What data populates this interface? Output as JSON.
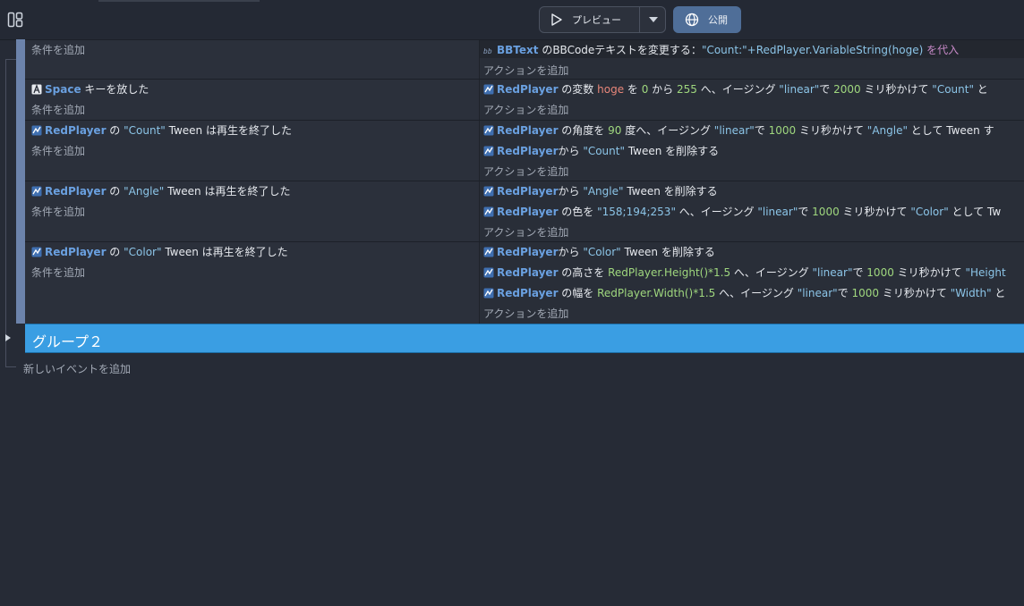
{
  "toolbar": {
    "preview_label": "プレビュー",
    "publish_label": "公開"
  },
  "events": [
    {
      "conditions": [],
      "add_condition": "条件を追加",
      "actions": [
        {
          "parts": [
            {
              "t": "obj",
              "v": "BBText"
            },
            {
              "t": "txt",
              "v": " のBBCodeテキストを変更する："
            },
            {
              "t": "str",
              "v": "\"Count:\"+RedPlayer.VariableString(hoge)"
            },
            {
              "t": "assign",
              "v": " を代入"
            }
          ],
          "icon": "text-object-icon"
        }
      ],
      "add_action": "アクションを追加"
    },
    {
      "conditions": [
        {
          "parts": [
            {
              "t": "obj",
              "v": "Space"
            },
            {
              "t": "txt",
              "v": " キーを放した"
            }
          ],
          "icon": "keyboard-key-icon"
        }
      ],
      "add_condition": "条件を追加",
      "actions": [
        {
          "parts": [
            {
              "t": "obj",
              "v": "RedPlayer"
            },
            {
              "t": "txt",
              "v": " の変数 "
            },
            {
              "t": "var",
              "v": "hoge"
            },
            {
              "t": "txt",
              "v": " を "
            },
            {
              "t": "num",
              "v": "0"
            },
            {
              "t": "txt",
              "v": " から "
            },
            {
              "t": "num",
              "v": "255"
            },
            {
              "t": "txt",
              "v": " へ、イージング "
            },
            {
              "t": "str",
              "v": "\"linear\""
            },
            {
              "t": "txt",
              "v": "で "
            },
            {
              "t": "num",
              "v": "2000"
            },
            {
              "t": "txt",
              "v": " ミリ秒かけて "
            },
            {
              "t": "str",
              "v": "\"Count\""
            },
            {
              "t": "txt",
              "v": " と"
            }
          ],
          "icon": "sprite-icon"
        }
      ],
      "add_action": "アクションを追加"
    },
    {
      "conditions": [
        {
          "parts": [
            {
              "t": "obj",
              "v": "RedPlayer"
            },
            {
              "t": "txt",
              "v": " の "
            },
            {
              "t": "str",
              "v": "\"Count\""
            },
            {
              "t": "txt",
              "v": " Tween は再生を終了した"
            }
          ],
          "icon": "sprite-icon"
        }
      ],
      "add_condition": "条件を追加",
      "actions": [
        {
          "parts": [
            {
              "t": "obj",
              "v": "RedPlayer"
            },
            {
              "t": "txt",
              "v": " の角度を "
            },
            {
              "t": "num",
              "v": "90"
            },
            {
              "t": "txt",
              "v": " 度へ、イージング "
            },
            {
              "t": "str",
              "v": "\"linear\""
            },
            {
              "t": "txt",
              "v": "で "
            },
            {
              "t": "num",
              "v": "1000"
            },
            {
              "t": "txt",
              "v": " ミリ秒かけて "
            },
            {
              "t": "str",
              "v": "\"Angle\""
            },
            {
              "t": "txt",
              "v": " として Tween す"
            }
          ],
          "icon": "sprite-icon"
        },
        {
          "parts": [
            {
              "t": "obj",
              "v": "RedPlayer"
            },
            {
              "t": "txt",
              "v": "から "
            },
            {
              "t": "str",
              "v": "\"Count\""
            },
            {
              "t": "txt",
              "v": " Tween を削除する"
            }
          ],
          "icon": "sprite-icon"
        }
      ],
      "add_action": "アクションを追加"
    },
    {
      "conditions": [
        {
          "parts": [
            {
              "t": "obj",
              "v": "RedPlayer"
            },
            {
              "t": "txt",
              "v": " の "
            },
            {
              "t": "str",
              "v": "\"Angle\""
            },
            {
              "t": "txt",
              "v": " Tween は再生を終了した"
            }
          ],
          "icon": "sprite-icon"
        }
      ],
      "add_condition": "条件を追加",
      "actions": [
        {
          "parts": [
            {
              "t": "obj",
              "v": "RedPlayer"
            },
            {
              "t": "txt",
              "v": "から "
            },
            {
              "t": "str",
              "v": "\"Angle\""
            },
            {
              "t": "txt",
              "v": " Tween を削除する"
            }
          ],
          "icon": "sprite-icon"
        },
        {
          "parts": [
            {
              "t": "obj",
              "v": "RedPlayer"
            },
            {
              "t": "txt",
              "v": " の色を "
            },
            {
              "t": "str",
              "v": "\"158;194;253\""
            },
            {
              "t": "txt",
              "v": " へ、イージング "
            },
            {
              "t": "str",
              "v": "\"linear\""
            },
            {
              "t": "txt",
              "v": "で "
            },
            {
              "t": "num",
              "v": "1000"
            },
            {
              "t": "txt",
              "v": " ミリ秒かけて "
            },
            {
              "t": "str",
              "v": "\"Color\""
            },
            {
              "t": "txt",
              "v": " として Tw"
            }
          ],
          "icon": "sprite-icon"
        }
      ],
      "add_action": "アクションを追加"
    },
    {
      "conditions": [
        {
          "parts": [
            {
              "t": "obj",
              "v": "RedPlayer"
            },
            {
              "t": "txt",
              "v": " の "
            },
            {
              "t": "str",
              "v": "\"Color\""
            },
            {
              "t": "txt",
              "v": " Tween は再生を終了した"
            }
          ],
          "icon": "sprite-icon"
        }
      ],
      "add_condition": "条件を追加",
      "actions": [
        {
          "parts": [
            {
              "t": "obj",
              "v": "RedPlayer"
            },
            {
              "t": "txt",
              "v": "から "
            },
            {
              "t": "str",
              "v": "\"Color\""
            },
            {
              "t": "txt",
              "v": " Tween を削除する"
            }
          ],
          "icon": "sprite-icon"
        },
        {
          "parts": [
            {
              "t": "obj",
              "v": "RedPlayer"
            },
            {
              "t": "txt",
              "v": " の高さを "
            },
            {
              "t": "expr",
              "v": "RedPlayer.Height()*1.5"
            },
            {
              "t": "txt",
              "v": " へ、イージング "
            },
            {
              "t": "str",
              "v": "\"linear\""
            },
            {
              "t": "txt",
              "v": "で "
            },
            {
              "t": "num",
              "v": "1000"
            },
            {
              "t": "txt",
              "v": " ミリ秒かけて "
            },
            {
              "t": "str",
              "v": "\"Height"
            }
          ],
          "icon": "sprite-icon"
        },
        {
          "parts": [
            {
              "t": "obj",
              "v": "RedPlayer"
            },
            {
              "t": "txt",
              "v": " の幅を "
            },
            {
              "t": "expr",
              "v": "RedPlayer.Width()*1.5"
            },
            {
              "t": "txt",
              "v": " へ、イージング "
            },
            {
              "t": "str",
              "v": "\"linear\""
            },
            {
              "t": "txt",
              "v": "で "
            },
            {
              "t": "num",
              "v": "1000"
            },
            {
              "t": "txt",
              "v": " ミリ秒かけて "
            },
            {
              "t": "str",
              "v": "\"Width\""
            },
            {
              "t": "txt",
              "v": " と"
            }
          ],
          "icon": "sprite-icon"
        }
      ],
      "add_action": "アクションを追加"
    }
  ],
  "group": {
    "title": "グループ２"
  },
  "add_event": "新しいイベントを追加",
  "colors": {
    "background": "#262b36",
    "event_bar": "#6c83ab",
    "group": "#3a9ee3",
    "object_name": "#6aa0e0",
    "string": "#8cc5e8",
    "number": "#9fd77e",
    "variable": "#e8867a"
  }
}
